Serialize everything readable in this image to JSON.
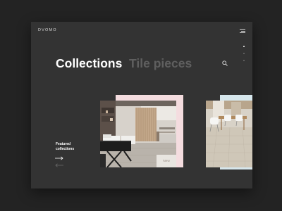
{
  "header": {
    "brand": "DVOMO"
  },
  "tabs": [
    {
      "label": "Collections",
      "active": true
    },
    {
      "label": "Tile pieces",
      "active": false
    }
  ],
  "featured": {
    "line1": "Featured",
    "line2": "collections"
  },
  "cards": [
    {
      "badge": "New"
    }
  ],
  "colors": {
    "background": "#232323",
    "panel": "#333333",
    "card1_accent": "#f4dcdf",
    "card2_accent": "#d6e6ec"
  }
}
